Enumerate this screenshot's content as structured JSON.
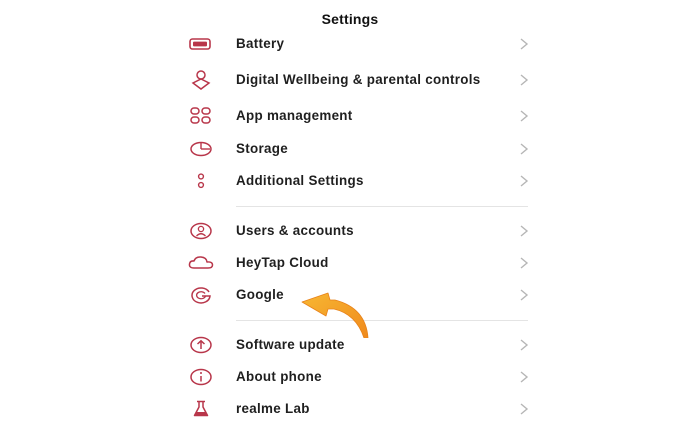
{
  "header": {
    "title": "Settings"
  },
  "colors": {
    "icon": "#b8364a",
    "chevron": "#b6b6b6",
    "arrow": "#f5a623"
  },
  "items": [
    {
      "label": "Battery",
      "icon": "battery-icon"
    },
    {
      "label": "Digital Wellbeing & parental controls",
      "icon": "wellbeing-icon"
    },
    {
      "label": "App management",
      "icon": "app-management-icon"
    },
    {
      "label": "Storage",
      "icon": "storage-icon"
    },
    {
      "label": "Additional Settings",
      "icon": "additional-settings-icon"
    },
    {
      "label": "Users & accounts",
      "icon": "users-icon"
    },
    {
      "label": "HeyTap Cloud",
      "icon": "cloud-icon"
    },
    {
      "label": "Google",
      "icon": "google-icon"
    },
    {
      "label": "Software update",
      "icon": "software-update-icon"
    },
    {
      "label": "About phone",
      "icon": "info-icon"
    },
    {
      "label": "realme Lab",
      "icon": "lab-icon"
    }
  ]
}
